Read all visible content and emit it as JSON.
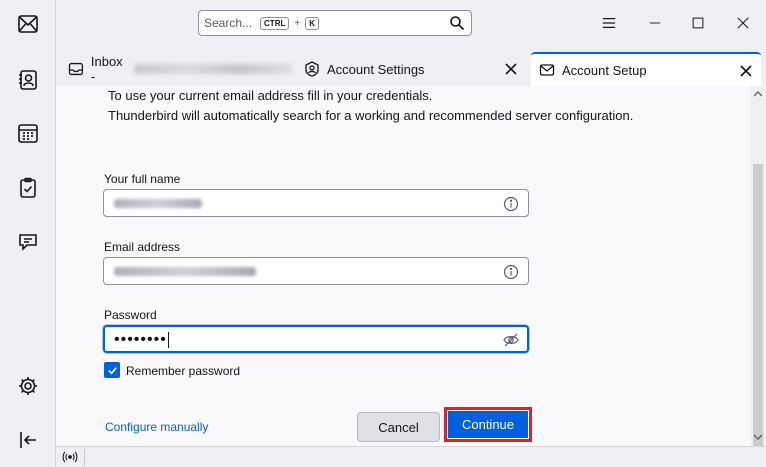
{
  "spaces": {
    "items": [
      {
        "name": "mail",
        "icon": "mail-icon"
      },
      {
        "name": "address-book",
        "icon": "address-book-icon"
      },
      {
        "name": "calendar",
        "icon": "calendar-icon"
      },
      {
        "name": "tasks",
        "icon": "tasks-icon"
      },
      {
        "name": "chat",
        "icon": "chat-icon"
      }
    ],
    "bottom": [
      {
        "name": "settings",
        "icon": "gear-icon"
      },
      {
        "name": "collapse",
        "icon": "collapse-left-icon"
      }
    ]
  },
  "search": {
    "placeholder": "Search...",
    "shortcut_key1": "CTRL",
    "shortcut_plus": "+",
    "shortcut_key2": "K"
  },
  "tabs": [
    {
      "label": "Inbox - ",
      "icon": "inbox-icon",
      "active": false
    },
    {
      "label": "Account Settings",
      "icon": "gear-badge-icon",
      "active": false
    },
    {
      "label": "Account Setup",
      "icon": "mail-setup-icon",
      "active": true
    }
  ],
  "form": {
    "intro_line1": "To use your current email address fill in your credentials.",
    "intro_line2": "Thunderbird will automatically search for a working and recommended server configuration.",
    "name_label": "Your full name",
    "email_label": "Email address",
    "password_label": "Password",
    "password_value": "••••••••",
    "remember_label": "Remember password",
    "remember_checked": true,
    "configure_link": "Configure manually",
    "cancel_label": "Cancel",
    "continue_label": "Continue"
  },
  "colors": {
    "accent": "#0060df",
    "highlight_border": "#d3262e"
  }
}
